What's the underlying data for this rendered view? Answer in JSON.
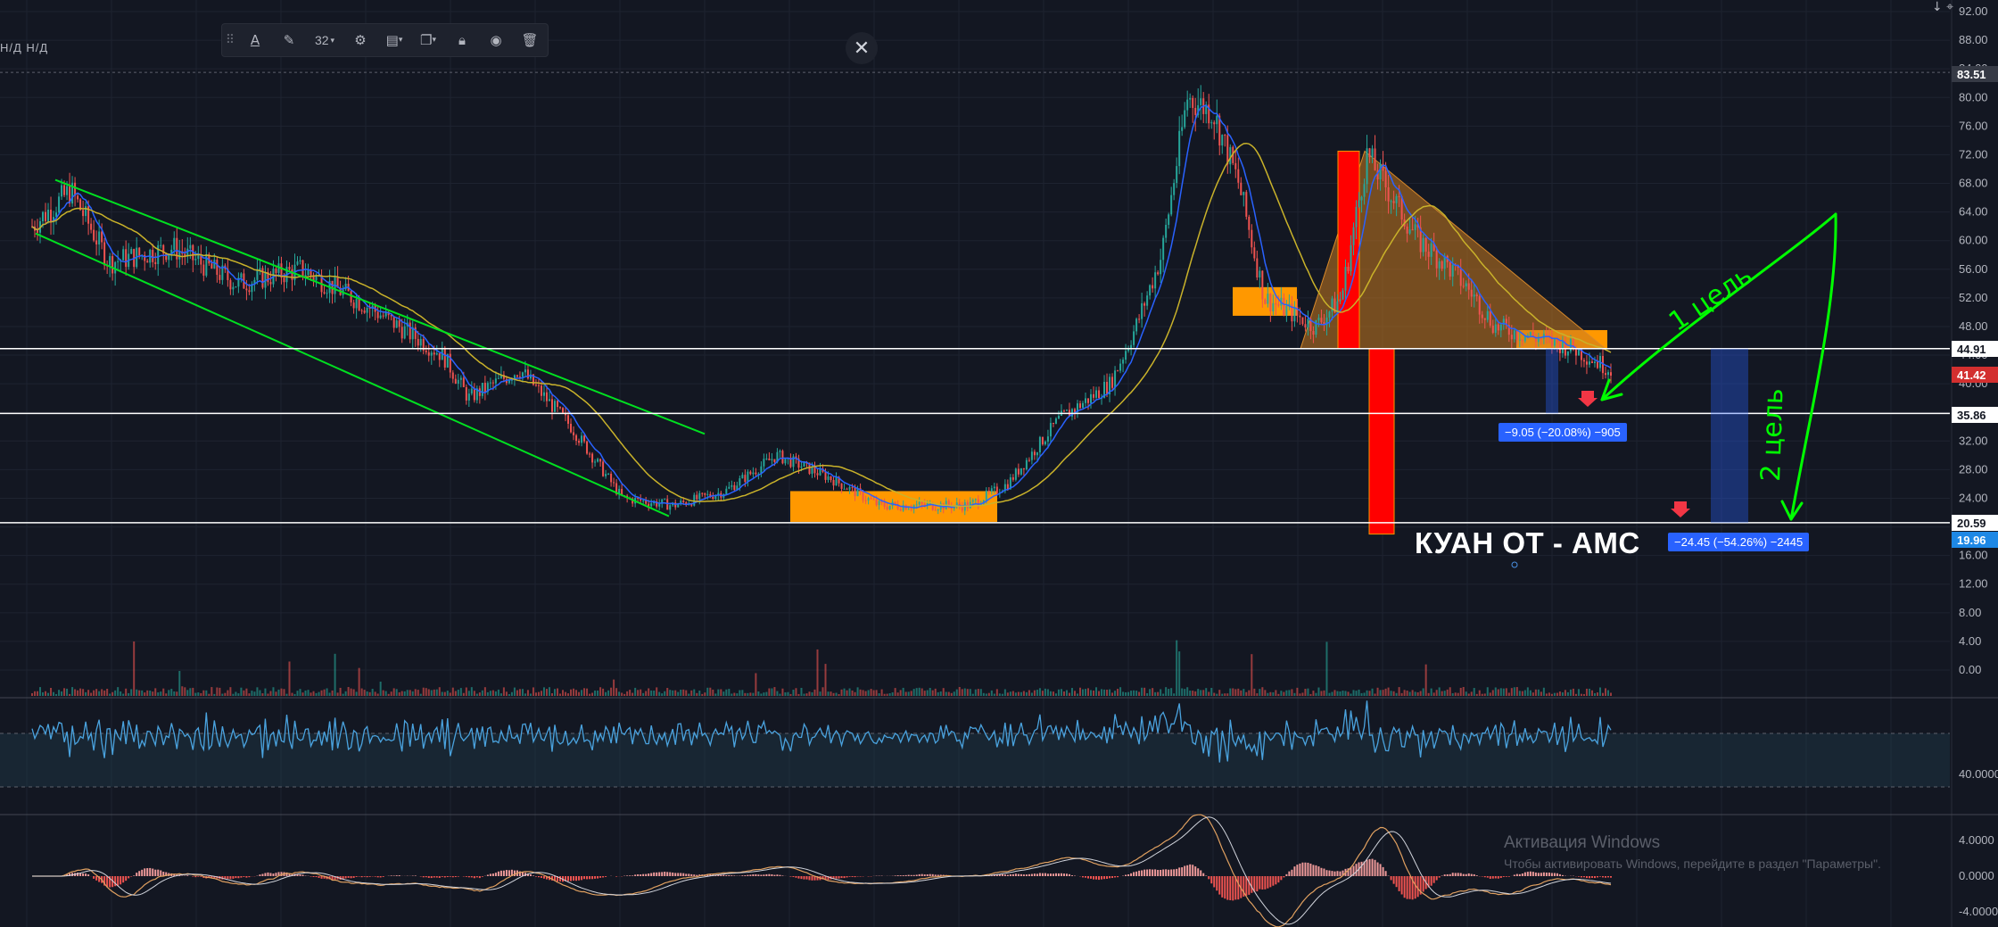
{
  "toolbar": {
    "font_size": "32",
    "grip_icon": "drag-handle-icon",
    "icons": [
      "text-color-icon",
      "pencil-icon",
      "gear-icon",
      "template-icon",
      "clone-icon",
      "lock-icon",
      "eye-icon",
      "trash-icon"
    ]
  },
  "header": {
    "na_label": "Н/Д Н/Д",
    "arrows": "↓  ⌖"
  },
  "close_label": "✕",
  "annotations": {
    "title": "КУАН ОТ - AMC",
    "measure1": "−9.05 (−20.08%) −905",
    "measure2": "−24.45 (−54.26%) −2445",
    "target1": "1 цель",
    "target2": "2 цель"
  },
  "price_tags": {
    "p8351": "83.51",
    "p4491": "44.91",
    "p4142": "41.42",
    "p3586": "35.86",
    "p2059": "20.59",
    "p1996": "19.96"
  },
  "watermark": {
    "line1": "Активация Windows",
    "line2": "Чтобы активировать Windows, перейдите в раздел \"Параметры\"."
  },
  "colors": {
    "bg": "#131722",
    "grid": "#1e2330",
    "up": "#26a69a",
    "down": "#ef5350",
    "ma_fast": "#2962ff",
    "ma_slow": "#c9b22a",
    "channel": "#00e020",
    "zone": "#ff9800",
    "red": "#ff0000",
    "rsi": "#4aa3df",
    "measure": "#2962ff"
  },
  "chart_data": {
    "type": "candlestick",
    "panes": [
      {
        "name": "price",
        "y_ticks": [
          "92.00",
          "88.00",
          "84.00",
          "80.00",
          "76.00",
          "72.00",
          "68.00",
          "64.00",
          "60.00",
          "56.00",
          "52.00",
          "48.00",
          "44.00",
          "40.00",
          "36.00",
          "32.00",
          "28.00",
          "24.00",
          "20.00",
          "16.00",
          "12.00",
          "8.00",
          "4.00",
          "0.00"
        ],
        "ylim": [
          -1.5,
          93
        ],
        "horizontal_levels": [
          44.91,
          35.86,
          20.59
        ],
        "anchor_points": [
          [
            0,
            62
          ],
          [
            30,
            67
          ],
          [
            60,
            57
          ],
          [
            110,
            59
          ],
          [
            160,
            54
          ],
          [
            210,
            56
          ],
          [
            260,
            51
          ],
          [
            320,
            44
          ],
          [
            340,
            38
          ],
          [
            380,
            42
          ],
          [
            420,
            34
          ],
          [
            460,
            24
          ],
          [
            500,
            23
          ],
          [
            540,
            25
          ],
          [
            580,
            30
          ],
          [
            620,
            27
          ],
          [
            660,
            23
          ],
          [
            730,
            23
          ],
          [
            760,
            26
          ],
          [
            800,
            35
          ],
          [
            840,
            40
          ],
          [
            860,
            48
          ],
          [
            880,
            58
          ],
          [
            900,
            80
          ],
          [
            920,
            78
          ],
          [
            940,
            68
          ],
          [
            960,
            52
          ],
          [
            980,
            50
          ],
          [
            1000,
            48
          ],
          [
            1020,
            52
          ],
          [
            1040,
            72
          ],
          [
            1060,
            66
          ],
          [
            1080,
            60
          ],
          [
            1100,
            57
          ],
          [
            1120,
            53
          ],
          [
            1140,
            48
          ],
          [
            1160,
            47
          ],
          [
            1180,
            46
          ],
          [
            1200,
            45
          ],
          [
            1230,
            42
          ]
        ]
      },
      {
        "name": "volume"
      },
      {
        "name": "rsi",
        "y_ticks": [
          "40.0000"
        ],
        "band": [
          30,
          70
        ]
      },
      {
        "name": "macd",
        "y_ticks": [
          "4.0000",
          "0.0000",
          "-4.0000"
        ]
      }
    ]
  }
}
